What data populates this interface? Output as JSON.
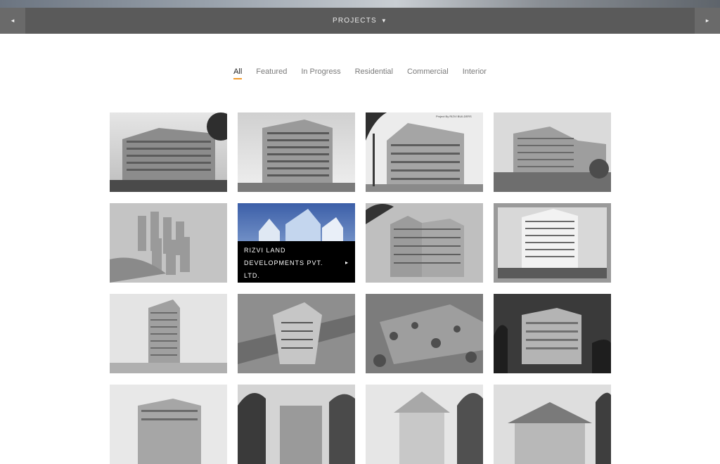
{
  "nav": {
    "title": "PROJECTS",
    "caret": "▼",
    "prev_glyph": "◂",
    "next_glyph": "▸"
  },
  "filters": [
    "All",
    "Featured",
    "In Progress",
    "Residential",
    "Commercial",
    "Interior"
  ],
  "active_filter": "All",
  "accent_color": "#f39a2b",
  "tiles": [
    {
      "kind": "apartment-complex"
    },
    {
      "kind": "highrise-tower"
    },
    {
      "kind": "apartment-palms",
      "caption": "Project By RIZVI BUILDERS"
    },
    {
      "kind": "curved-building"
    },
    {
      "kind": "aerial-towers"
    },
    {
      "kind": "blue-towers",
      "hover_title": "RIZVI LAND DEVELOPMENTS PVT. LTD.",
      "hover_arrow": "▸"
    },
    {
      "kind": "tower-trees"
    },
    {
      "kind": "residential-tower"
    },
    {
      "kind": "tall-tower"
    },
    {
      "kind": "curved-commercial"
    },
    {
      "kind": "aerial-township"
    },
    {
      "kind": "mall-building"
    },
    {
      "kind": "modern-building"
    },
    {
      "kind": "villa-palms"
    },
    {
      "kind": "colonial-mansion"
    },
    {
      "kind": "bungalow"
    }
  ]
}
